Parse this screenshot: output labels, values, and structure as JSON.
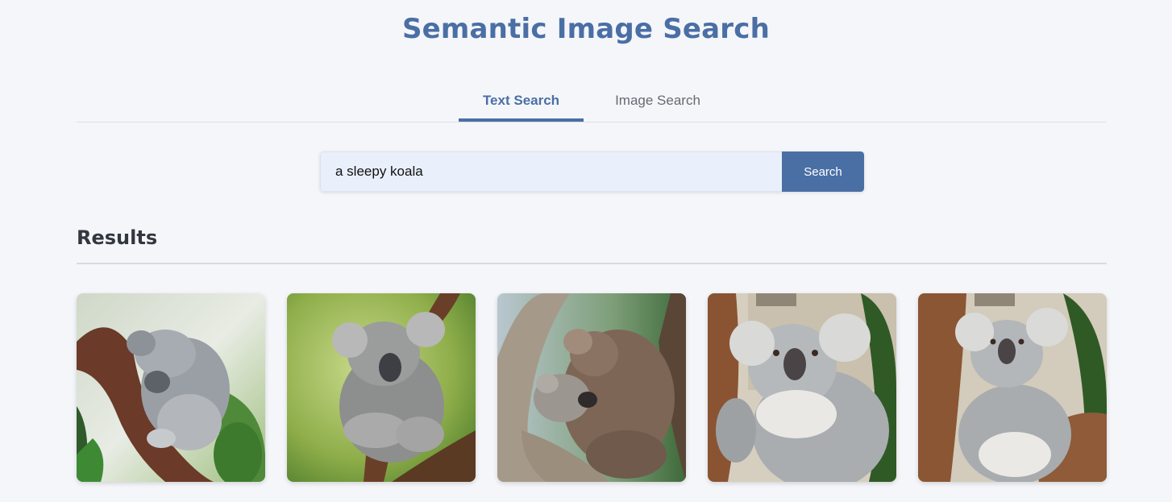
{
  "app": {
    "title": "Semantic Image Search"
  },
  "tabs": [
    {
      "label": "Text Search",
      "active": true
    },
    {
      "label": "Image Search",
      "active": false
    }
  ],
  "search": {
    "value": "a sleepy koala",
    "button_label": "Search"
  },
  "results": {
    "heading": "Results",
    "items": [
      {
        "alt": "koala-sleeping-on-branch"
      },
      {
        "alt": "koala-hugging-branch"
      },
      {
        "alt": "koala-with-joey"
      },
      {
        "alt": "koala-portrait-1"
      },
      {
        "alt": "koala-portrait-2"
      }
    ]
  },
  "colors": {
    "accent": "#4a6fa5",
    "background": "#f5f6fa",
    "input_background": "#e9f0fb"
  }
}
